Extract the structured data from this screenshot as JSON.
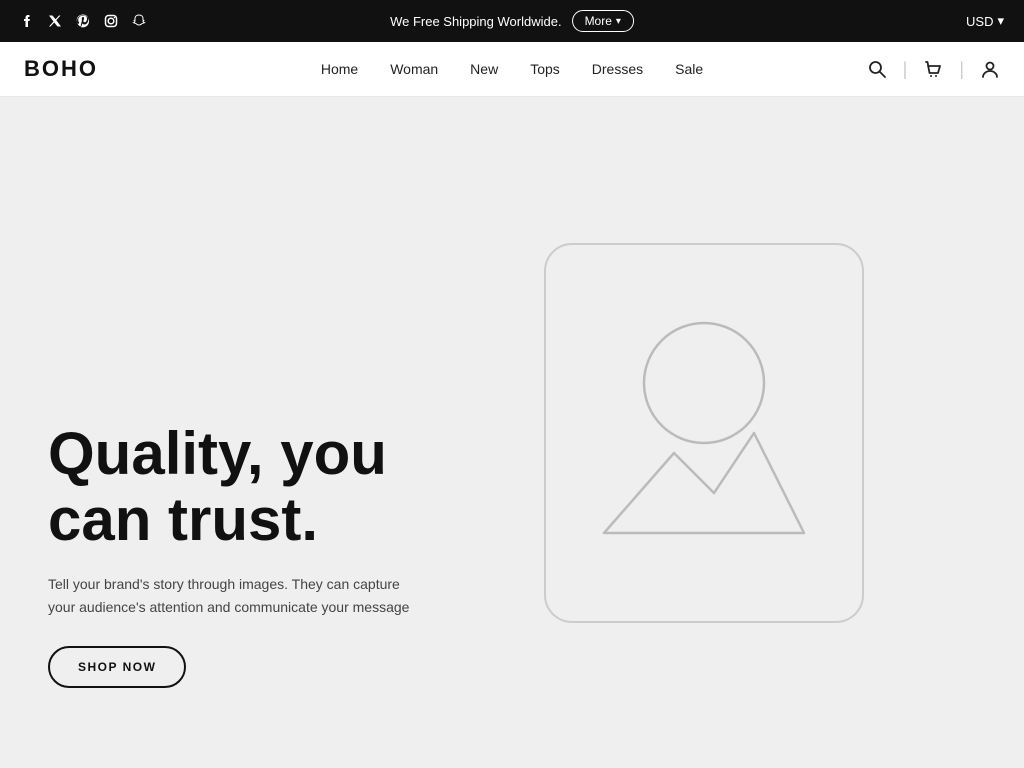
{
  "announcement_bar": {
    "shipping_text": "We Free Shipping Worldwide.",
    "more_button_label": "More",
    "currency_label": "USD",
    "currency_arrow": "▾"
  },
  "social_icons": [
    {
      "name": "facebook",
      "symbol": "f"
    },
    {
      "name": "twitter",
      "symbol": "𝕏"
    },
    {
      "name": "pinterest",
      "symbol": "P"
    },
    {
      "name": "instagram",
      "symbol": "◻"
    },
    {
      "name": "snapchat",
      "symbol": "👻"
    }
  ],
  "nav": {
    "brand": "BOHO",
    "links": [
      {
        "label": "Home",
        "key": "home"
      },
      {
        "label": "Woman",
        "key": "woman"
      },
      {
        "label": "New",
        "key": "new"
      },
      {
        "label": "Tops",
        "key": "tops"
      },
      {
        "label": "Dresses",
        "key": "dresses"
      },
      {
        "label": "Sale",
        "key": "sale"
      }
    ]
  },
  "hero": {
    "title": "Quality, you can trust.",
    "subtitle": "Tell your brand's story through images. They can capture your audience's attention and communicate your message",
    "cta_label": "SHOP NOW"
  }
}
